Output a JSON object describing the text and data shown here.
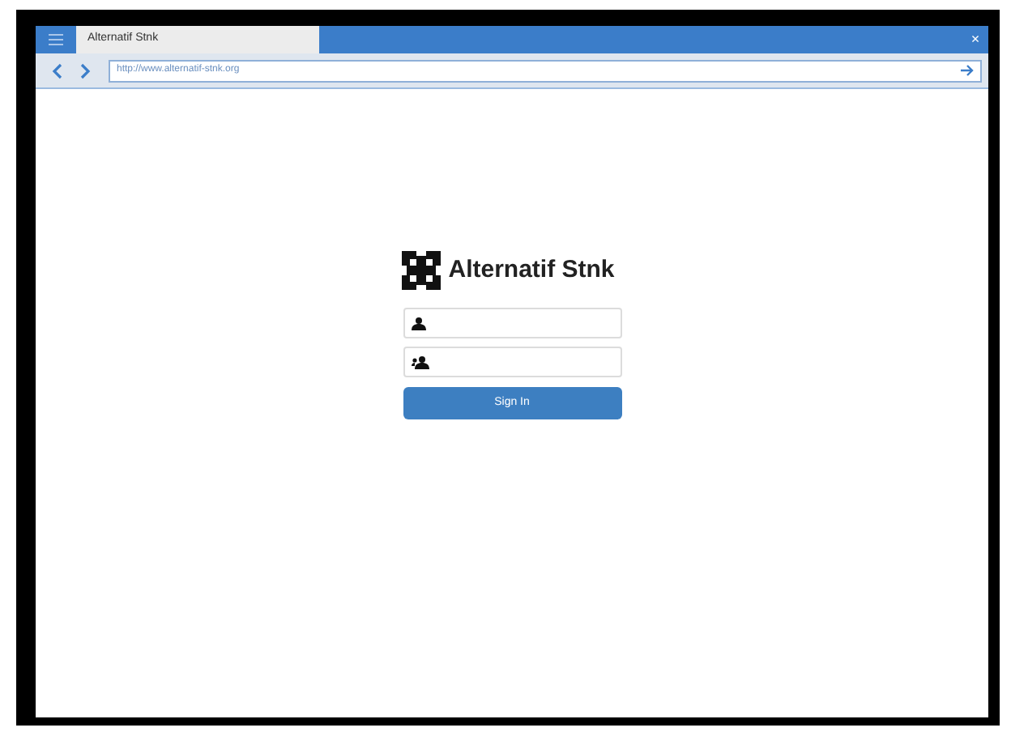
{
  "window": {
    "tab_title": "Alternatif Stnk",
    "close": "×"
  },
  "address_bar": {
    "url": "http://www.alternatif-stnk.org"
  },
  "login": {
    "brand": "Alternatif Stnk",
    "fields": [
      {
        "kind": "user"
      },
      {
        "kind": "password"
      }
    ],
    "button": "Sign In"
  }
}
